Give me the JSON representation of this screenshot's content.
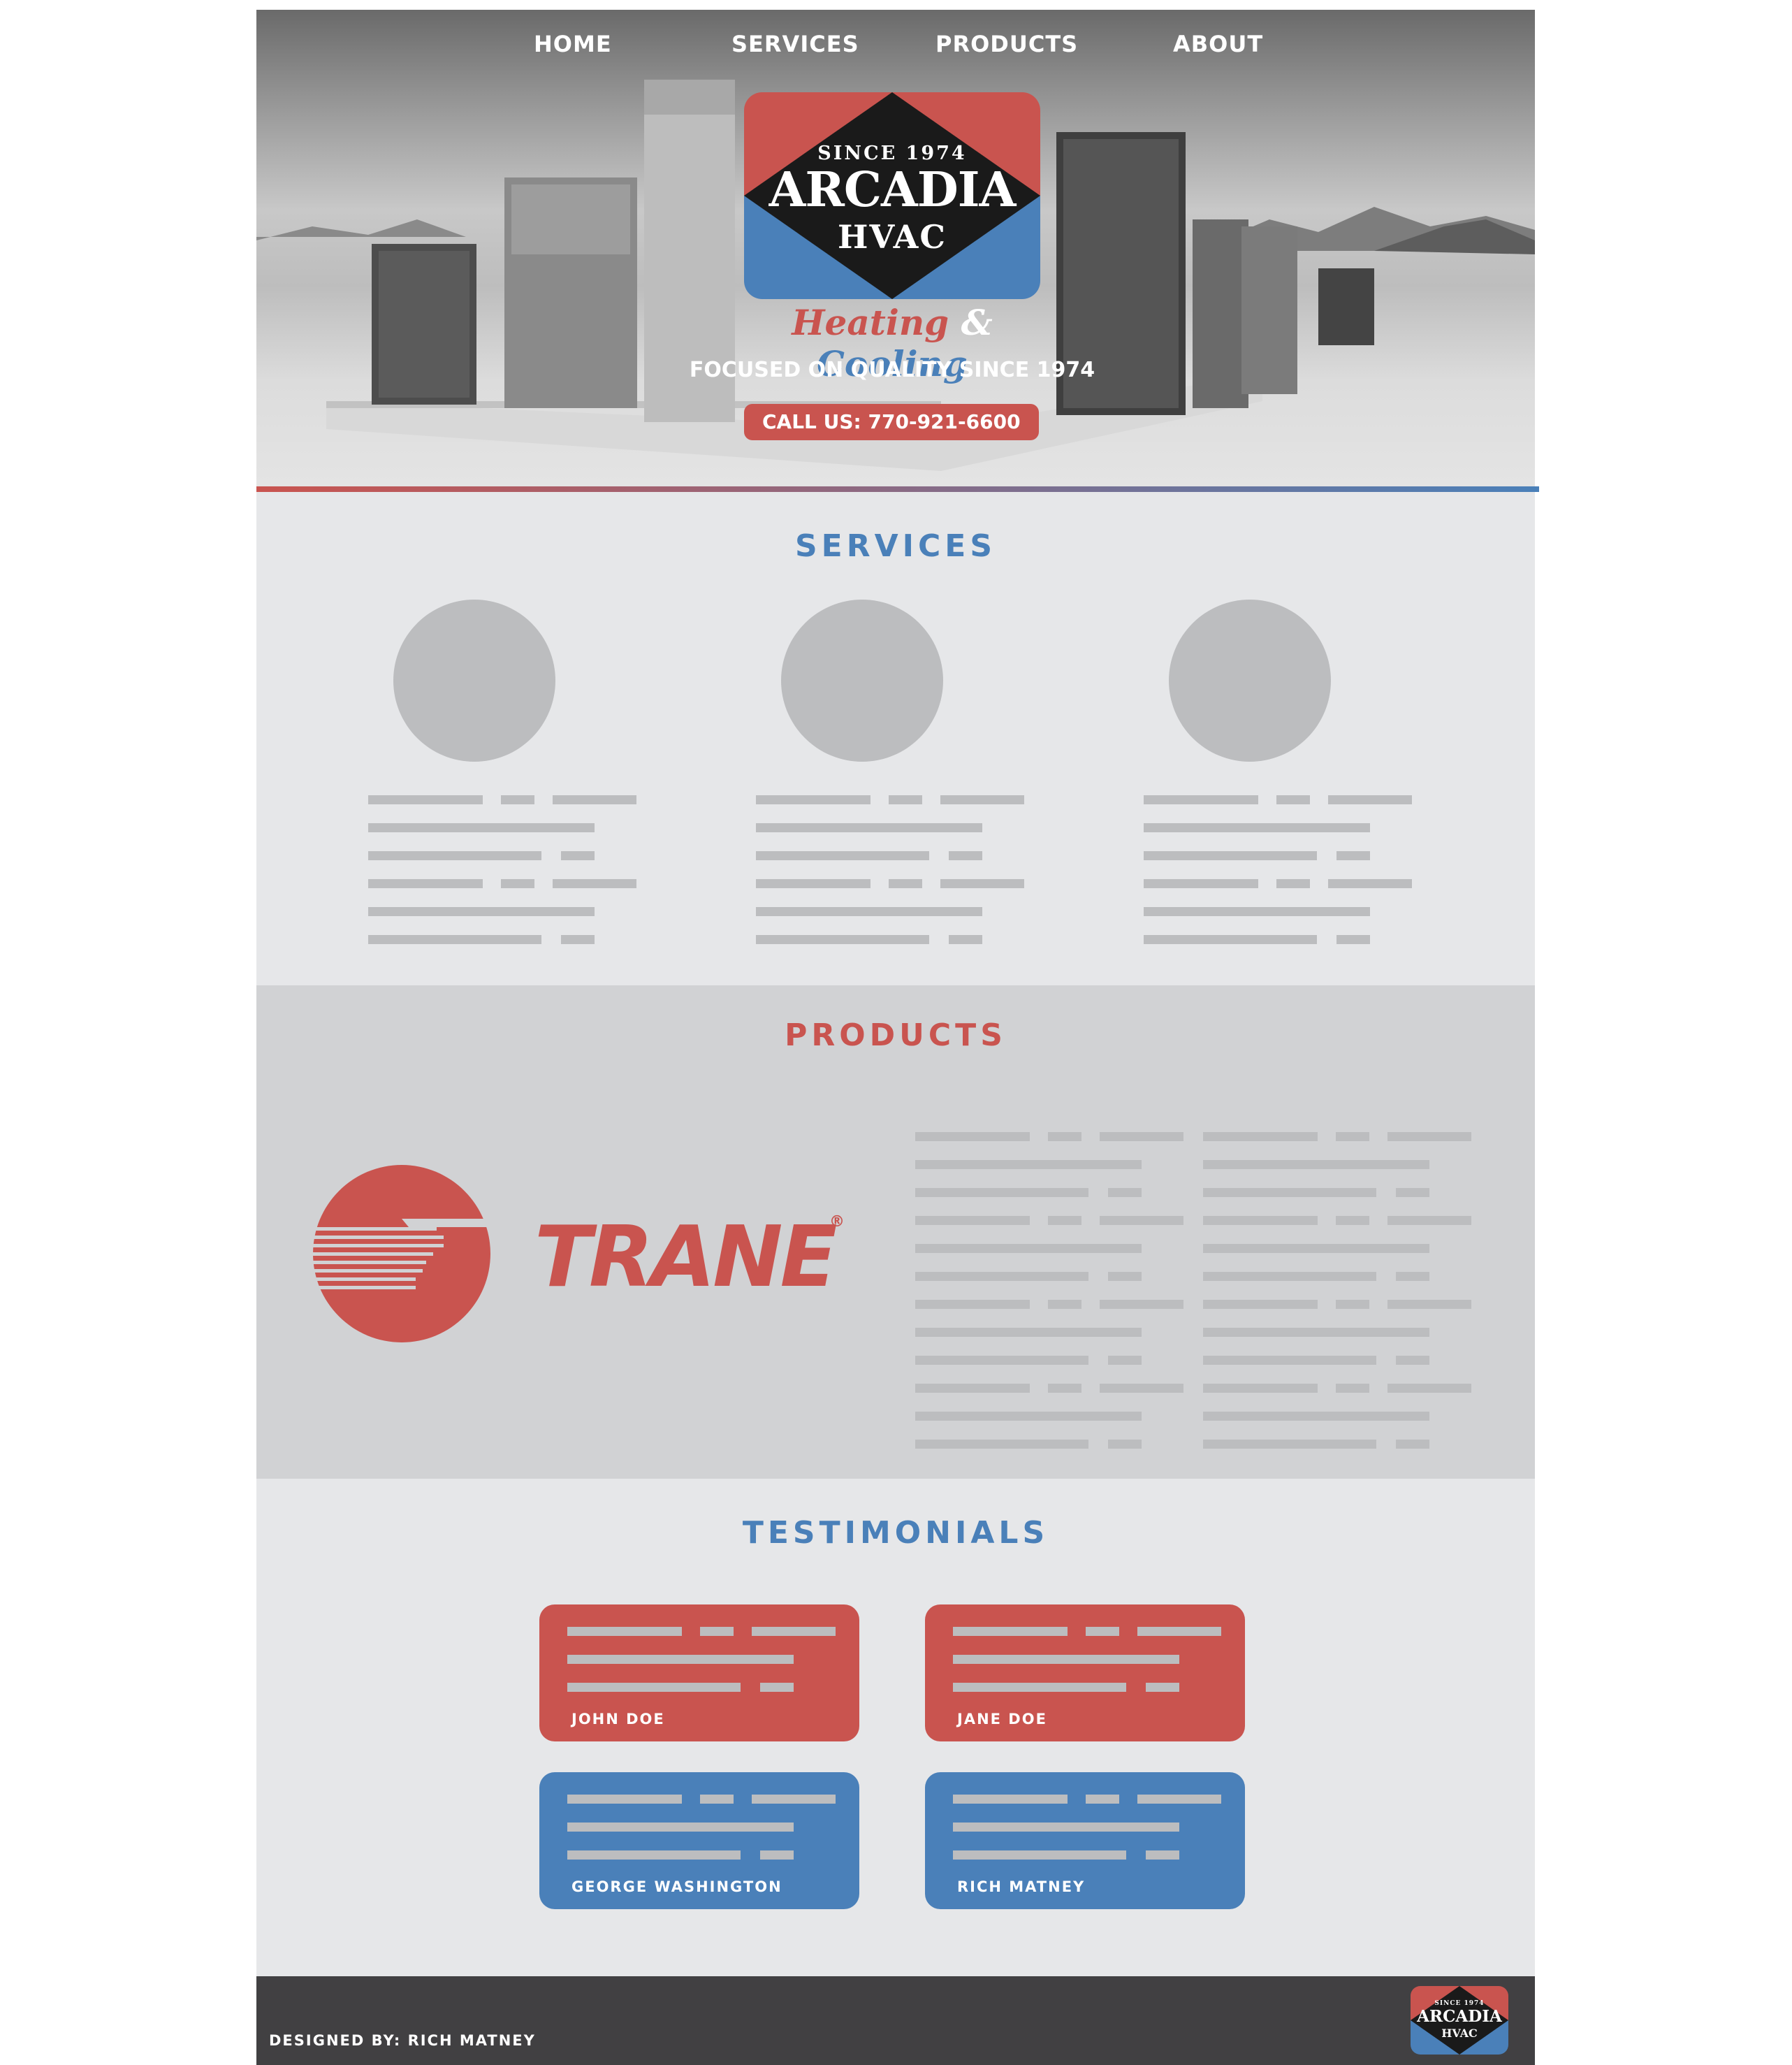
{
  "nav": {
    "items": [
      {
        "label": "HOME"
      },
      {
        "label": "SERVICES"
      },
      {
        "label": "PRODUCTS"
      },
      {
        "label": "ABOUT"
      }
    ]
  },
  "hero": {
    "logo": {
      "since": "SINCE 1974",
      "brand": "ARCADIA",
      "sub": "HVAC"
    },
    "tagline": {
      "heating": "Heating",
      "amp": "&",
      "cooling": "Cooling"
    },
    "focused": "FOCUSED ON QUALITY SINCE 1974",
    "call_label": "CALL US: 770-921-6600"
  },
  "services": {
    "title": "SERVICES"
  },
  "products": {
    "title": "PRODUCTS",
    "brand_name": "TRANE",
    "brand_mark": "®"
  },
  "testimonials": {
    "title": "TESTIMONIALS",
    "items": [
      {
        "name": "JOHN DOE",
        "color": "#c9544f"
      },
      {
        "name": "JANE DOE",
        "color": "#c9544f"
      },
      {
        "name": "GEORGE WASHINGTON",
        "color": "#4a80b9"
      },
      {
        "name": "RICH MATNEY",
        "color": "#4a80b9"
      }
    ]
  },
  "footer": {
    "credit": "DESIGNED BY: RICH MATNEY",
    "logo": {
      "since": "SINCE 1974",
      "brand": "ARCADIA",
      "sub": "HVAC"
    }
  },
  "colors": {
    "red": "#c9544f",
    "blue": "#4a80b9",
    "footer": "#414042",
    "placeholder": "#bcbdbf"
  }
}
